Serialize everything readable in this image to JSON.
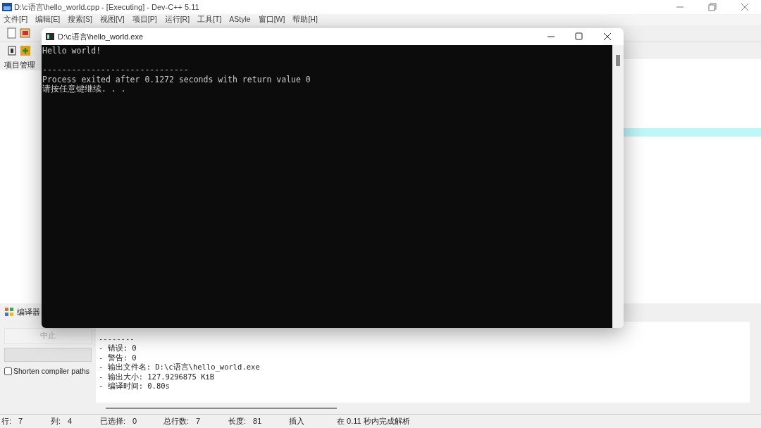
{
  "window": {
    "title": "D:\\c语言\\hello_world.cpp - [Executing] - Dev-C++ 5.11"
  },
  "menu": [
    "文件[F]",
    "编辑[E]",
    "搜索[S]",
    "视图[V]",
    "项目[P]",
    "运行[R]",
    "工具[T]",
    "AStyle",
    "窗口[W]",
    "帮助[H]"
  ],
  "project_panel": {
    "title": "项目管理"
  },
  "bottom_tabs": [
    {
      "label": "编译器",
      "selected": true
    }
  ],
  "compiler_panel": {
    "stop_button": {
      "label": "中止",
      "disabled": true
    },
    "progress": {
      "level": 0
    },
    "shorten_paths": {
      "label": "Shorten compiler paths",
      "checked": false
    },
    "output": [
      "--------",
      "- 错误: 0",
      "- 警告: 0",
      "- 输出文件名: D:\\c语言\\hello_world.exe",
      "- 输出大小: 127.9296875 KiB",
      "- 编译时间: 0.80s"
    ]
  },
  "status_bar": [
    {
      "label": "行:",
      "value": "7"
    },
    {
      "label": "列:",
      "value": "4"
    },
    {
      "label": "已选择:",
      "value": "0"
    },
    {
      "label": "总行数:",
      "value": "7"
    },
    {
      "label": "长度:",
      "value": "81"
    },
    {
      "label": "插入"
    },
    {
      "label": "在 0.11 秒内完成解析"
    }
  ],
  "console": {
    "title": "D:\\c语言\\hello_world.exe",
    "lines": [
      "Hello world!",
      "------------------------------",
      "Process exited after 0.1272 seconds with return value 0",
      "请按任意键继续. . ."
    ]
  }
}
